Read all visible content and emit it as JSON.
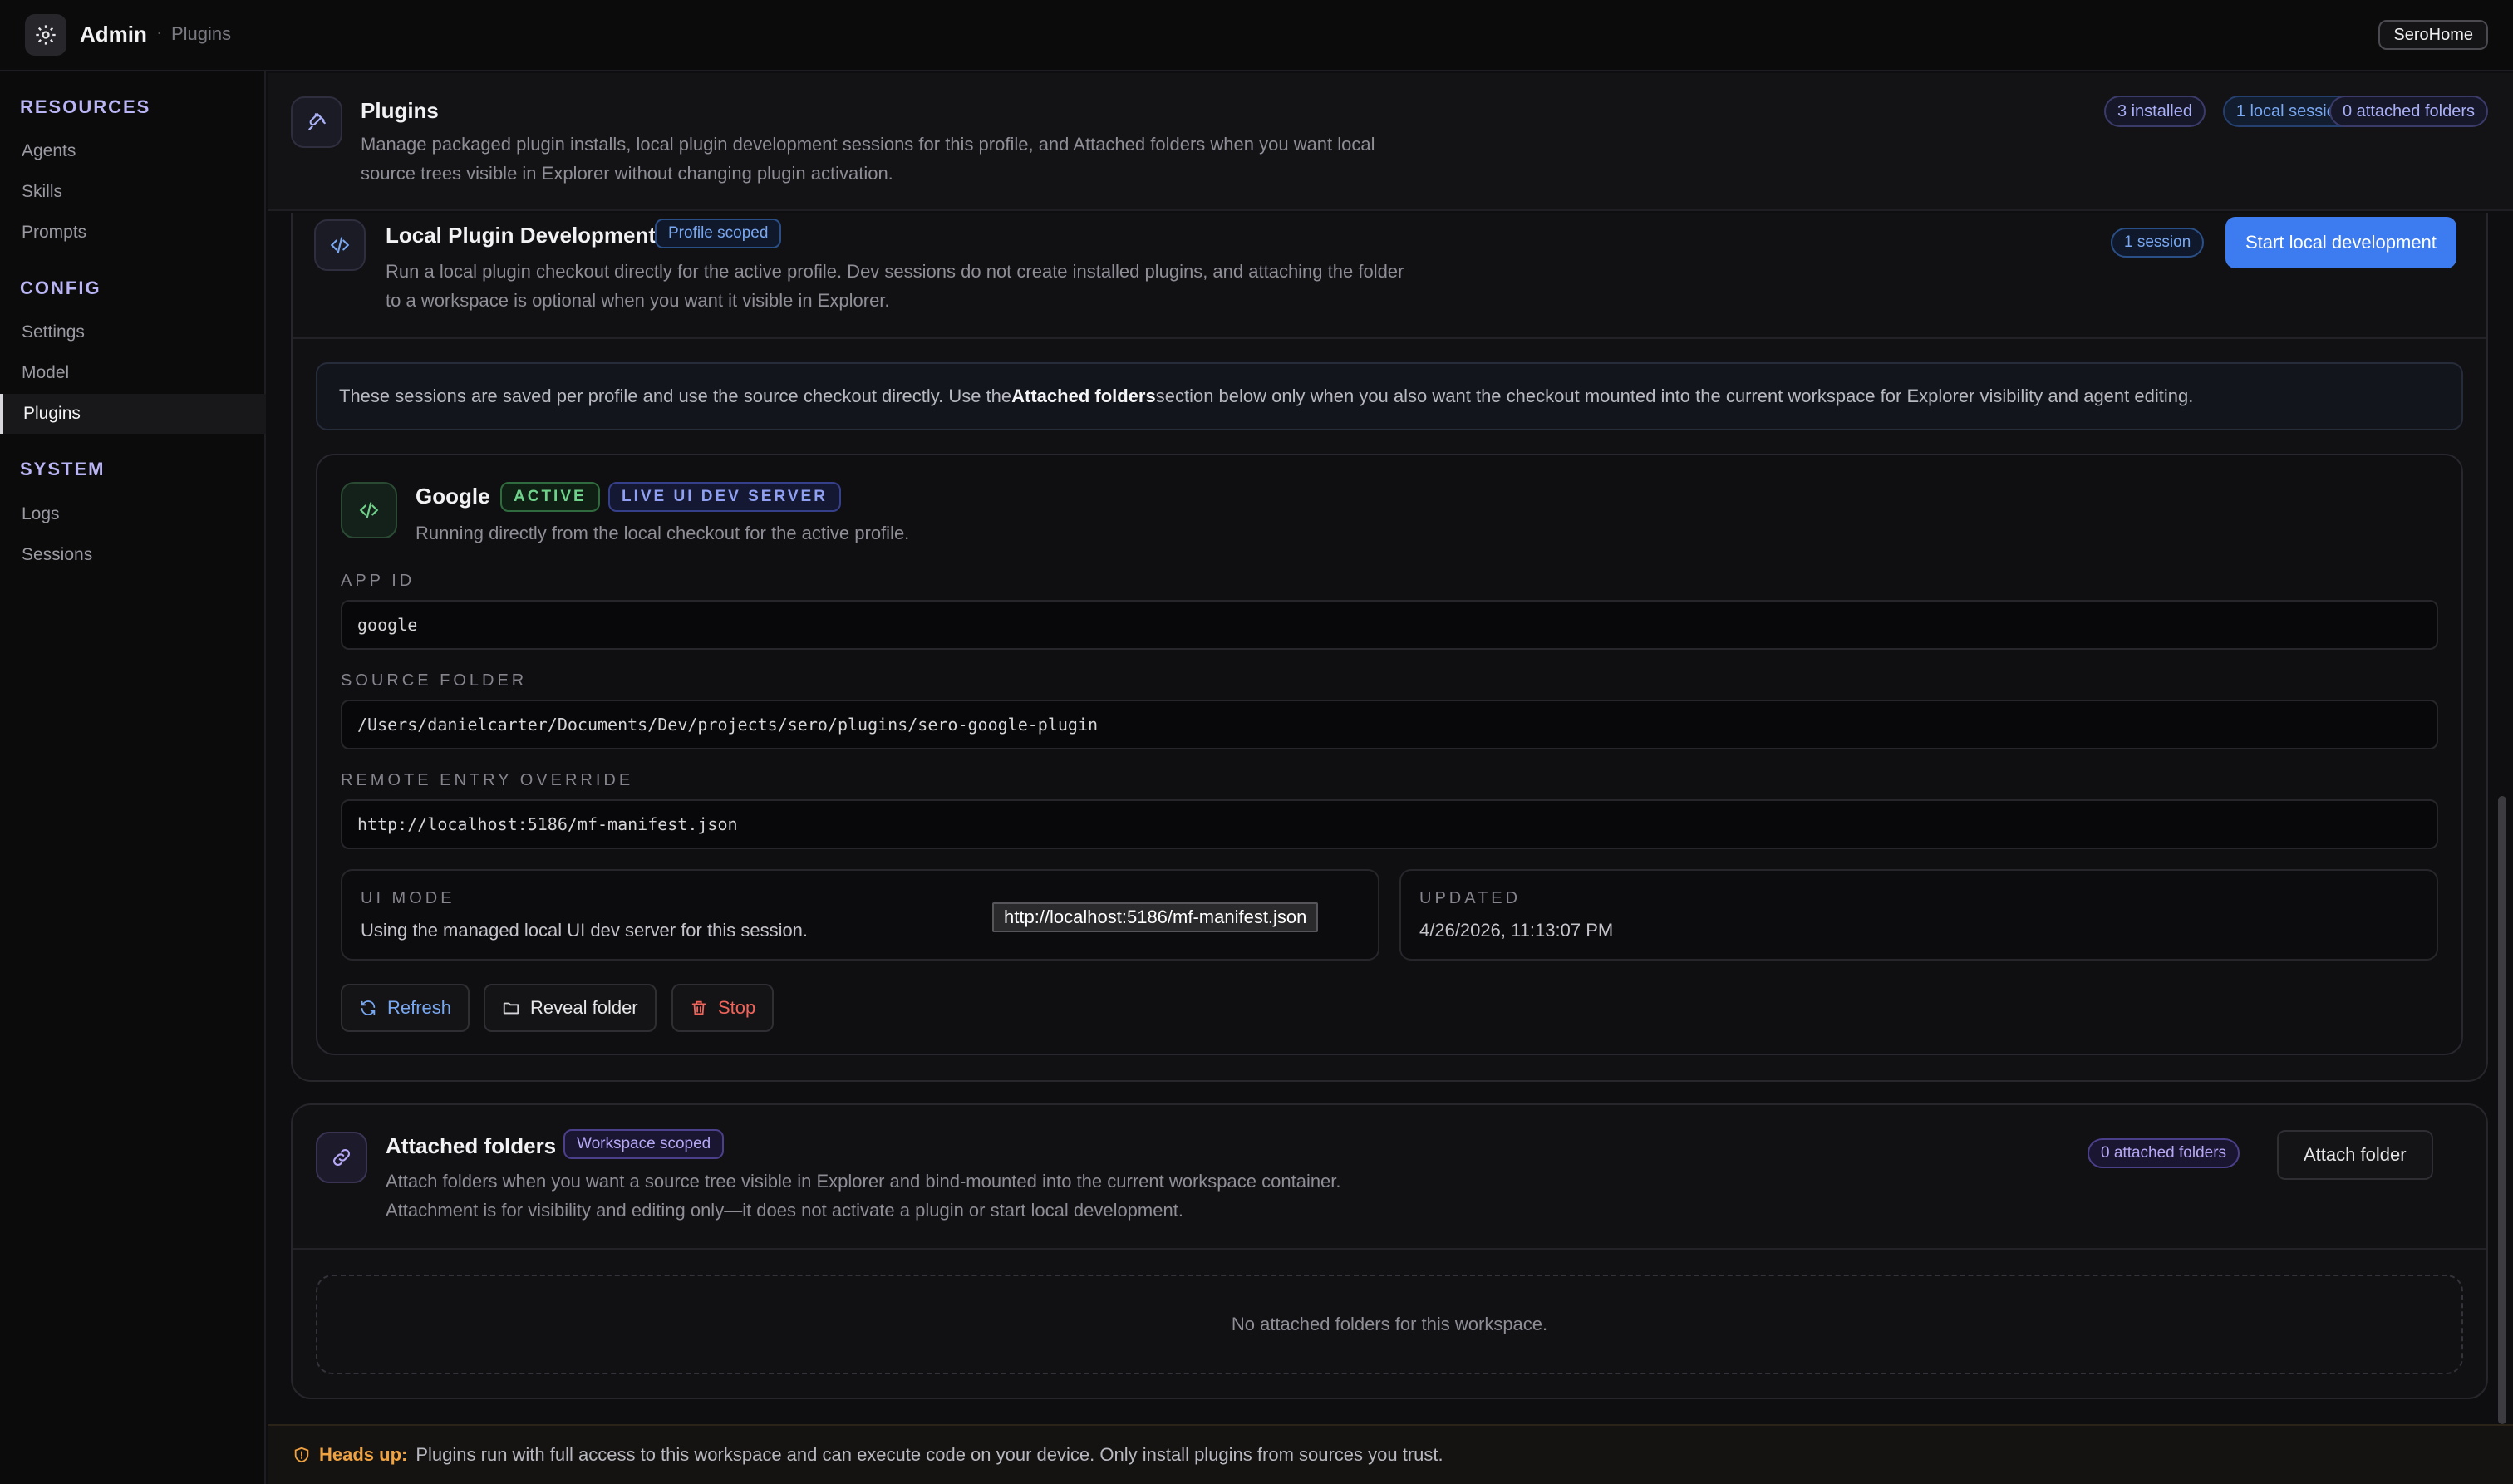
{
  "app": {
    "title": "Admin",
    "breadcrumb": "Plugins",
    "workspace": "SeroHome"
  },
  "sidebar": {
    "sections": [
      {
        "title": "RESOURCES",
        "items": [
          "Agents",
          "Skills",
          "Prompts"
        ]
      },
      {
        "title": "CONFIG",
        "items": [
          "Settings",
          "Model",
          "Plugins"
        ]
      },
      {
        "title": "SYSTEM",
        "items": [
          "Logs",
          "Sessions"
        ]
      }
    ],
    "active": "Plugins"
  },
  "header": {
    "title": "Plugins",
    "description_line1": "Manage packaged plugin installs, local plugin development sessions for this profile, and Attached folders when you want local",
    "description_line2": "source trees visible in Explorer without changing plugin activation.",
    "pills": [
      "3 installed",
      "1 local sessions",
      "0 attached folders"
    ]
  },
  "local_dev": {
    "title": "Local Plugin Development",
    "scope_badge": "Profile scoped",
    "description_line1": "Run a local plugin checkout directly for the active profile. Dev sessions do not create installed plugins, and attaching the folder",
    "description_line2": "to a workspace is optional when you want it visible in Explorer.",
    "session_count": "1 session",
    "start_button": "Start local development",
    "note_pre": "These sessions are saved per profile and use the source checkout directly. Use the ",
    "note_bold": "Attached folders",
    "note_post": " section below only when you also want the checkout mounted into the current workspace for Explorer visibility and agent editing."
  },
  "session": {
    "name": "Google",
    "status": "ACTIVE",
    "server_badge": "LIVE UI DEV SERVER",
    "subtitle": "Running directly from the local checkout for the active profile.",
    "app_id_label": "APP ID",
    "app_id": "google",
    "source_label": "SOURCE FOLDER",
    "source": "/Users/danielcarter/Documents/Dev/projects/sero/plugins/sero-google-plugin",
    "remote_label": "REMOTE ENTRY OVERRIDE",
    "remote": "http://localhost:5186/mf-manifest.json",
    "ui_mode_label": "UI MODE",
    "ui_mode": "Using the managed local UI dev server for this session.",
    "tooltip": "http://localhost:5186/mf-manifest.json",
    "updated_label": "UPDATED",
    "updated": "4/26/2026, 11:13:07 PM",
    "refresh": "Refresh",
    "reveal": "Reveal folder",
    "stop": "Stop"
  },
  "attached": {
    "title": "Attached folders",
    "scope_badge": "Workspace scoped",
    "description_line1": "Attach folders when you want a source tree visible in Explorer and bind-mounted into the current workspace container.",
    "description_line2": "Attachment is for visibility and editing only—it does not activate a plugin or start local development.",
    "count": "0 attached folders",
    "attach_button": "Attach folder",
    "empty": "No attached folders for this workspace."
  },
  "footer": {
    "label": "Heads up:",
    "text": "Plugins run with full access to this workspace and can execute code on your device. Only install plugins from sources you trust."
  },
  "colors": {
    "accent": "#3d7cf0",
    "warning": "#f0a240",
    "success": "#6fd28a",
    "danger": "#f0645a"
  },
  "icons": {
    "app": "gear-icon",
    "plugins": "plug-icon",
    "code": "code-icon",
    "link": "link-icon",
    "refresh": "refresh-icon",
    "folder": "folder-icon",
    "trash": "trash-icon",
    "shield": "shield-alert-icon"
  }
}
